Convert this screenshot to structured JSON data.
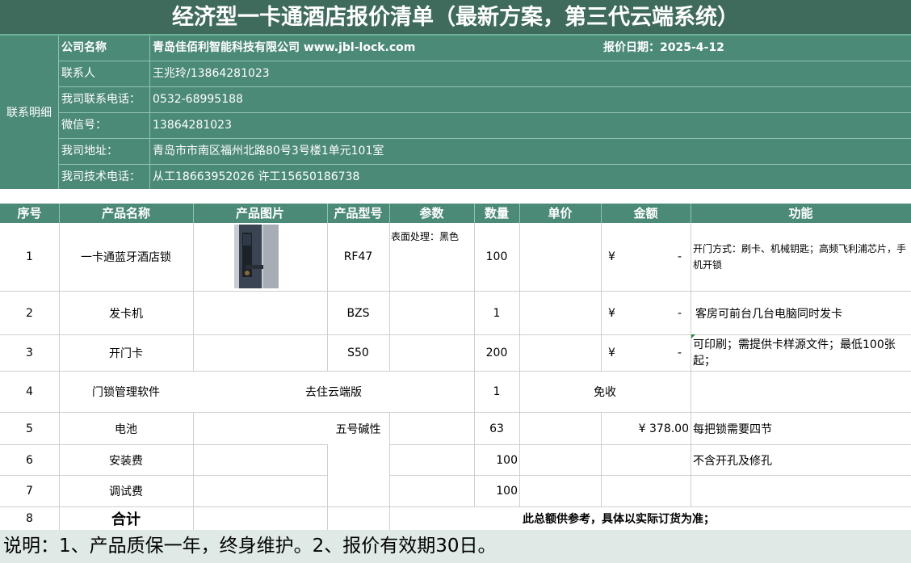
{
  "title": "经济型一卡通酒店报价清单（最新方案，第三代云端系统）",
  "contact": {
    "side_label": "联系明细",
    "rows": [
      {
        "label": "公司名称",
        "value": "青岛佳佰利智能科技有限公司  www.jbl-lock.com",
        "date": "报价日期：2025-4-12"
      },
      {
        "label": "联系人",
        "value": "王兆玲/13864281023"
      },
      {
        "label": "我司联系电话：",
        "value": "0532-68995188"
      },
      {
        "label": "微信号：",
        "value": "13864281023"
      },
      {
        "label": "我司地址：",
        "value": "青岛市市南区福州北路80号3号楼1单元101室"
      },
      {
        "label": "我司技术电话：",
        "value": "从工18663952026  许工15650186738"
      }
    ]
  },
  "table": {
    "headers": [
      "序号",
      "产品名称",
      "产品图片",
      "产品型号",
      "参数",
      "数量",
      "单价",
      "金额",
      "功能"
    ],
    "rows": [
      {
        "no": "1",
        "name": "一卡通蓝牙酒店锁",
        "image": "lock-photo",
        "model": "RF47",
        "param": "表面处理：黑色",
        "qty": "100",
        "price": "",
        "currency": "¥",
        "amount": "-",
        "func": "开门方式：刷卡、机械钥匙；高频飞利浦芯片，手机开锁"
      },
      {
        "no": "2",
        "name": "发卡机",
        "model": "BZS",
        "param": "",
        "qty": "1",
        "price": "",
        "currency": "¥",
        "amount": "-",
        "func": "客房可前台几台电脑同时发卡"
      },
      {
        "no": "3",
        "name": "开门卡",
        "model": "S50",
        "param": "",
        "qty": "200",
        "price": "",
        "currency": "¥",
        "amount": "-",
        "func": "可印刷；需提供卡样源文件；最低100张起；"
      },
      {
        "no": "4",
        "name": "门锁管理软件",
        "model_merged": "去住云端版",
        "qty": "1",
        "amount": "免收",
        "func": ""
      },
      {
        "no": "5",
        "name": "电池",
        "model": "五号碱性",
        "qty": "63",
        "amount": "¥ 378.00",
        "func": "每把锁需要四节"
      },
      {
        "no": "6",
        "name": "安装费",
        "qty": "100",
        "func": "不含开孔及修孔"
      },
      {
        "no": "7",
        "name": "调试费",
        "qty": "100",
        "func": ""
      },
      {
        "no": "8",
        "name": "合计",
        "note": "此总额供参考，具体以实际订货为准；"
      }
    ]
  },
  "footer": "说明：1、产品质保一年，终身维护。2、报价有效期30日。"
}
